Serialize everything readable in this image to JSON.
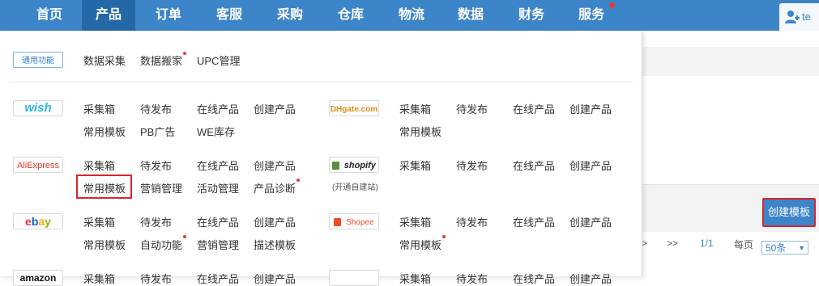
{
  "nav": {
    "items": [
      "首页",
      "产品",
      "订单",
      "客服",
      "采购",
      "仓库",
      "物流",
      "数据",
      "财务",
      "服务"
    ],
    "active_index": 1
  },
  "user": {
    "name_fragment": "te"
  },
  "colors": {
    "nav_bg": "#3c85c8",
    "nav_active": "#2468a7",
    "highlight_border": "#d8262d",
    "dot": "#e23a3a"
  },
  "general": {
    "logo": "通用功能",
    "links": [
      "数据采集",
      "数据搬家",
      "UPC管理"
    ]
  },
  "platforms": {
    "wish": {
      "logo": "wish",
      "row1": [
        "采集箱",
        "待发布",
        "在线产品",
        "创建产品"
      ],
      "row2": [
        "常用模板",
        "PB广告",
        "WE库存"
      ]
    },
    "aliexpress": {
      "logo": "AliExpress",
      "row1": [
        "采集箱",
        "待发布",
        "在线产品",
        "创建产品"
      ],
      "row2": [
        "常用模板",
        "营销管理",
        "活动管理",
        "产品诊断"
      ]
    },
    "ebay": {
      "logo": "ebay",
      "row1": [
        "采集箱",
        "待发布",
        "在线产品",
        "创建产品"
      ],
      "row2": [
        "常用模板",
        "自动功能",
        "营销管理",
        "描述模板"
      ]
    },
    "amazon": {
      "logo": "amazon",
      "row1": [
        "采集箱",
        "待发布",
        "在线产品",
        "创建产品"
      ]
    },
    "dhgate": {
      "logo": "DHgate.com",
      "row1": [
        "采集箱",
        "待发布",
        "在线产品",
        "创建产品"
      ],
      "row2": [
        "常用模板"
      ]
    },
    "shopify": {
      "logo": "shopify",
      "sub": "(开通自建站)",
      "row1": [
        "采集箱",
        "待发布",
        "在线产品",
        "创建产品"
      ]
    },
    "shopee": {
      "logo": "Shopee",
      "row1": [
        "采集箱",
        "待发布",
        "在线产品",
        "创建产品"
      ],
      "row2": [
        "常用模板"
      ]
    },
    "extra": {
      "row1": [
        "采集箱",
        "待发布",
        "在线产品",
        "创建产品"
      ]
    }
  },
  "right_panel": {
    "create_template_button": "创建模板",
    "pager": {
      "next": ">",
      "last": ">>",
      "page": "1/1",
      "per_page_label": "每页",
      "per_page_value": "50条"
    }
  }
}
